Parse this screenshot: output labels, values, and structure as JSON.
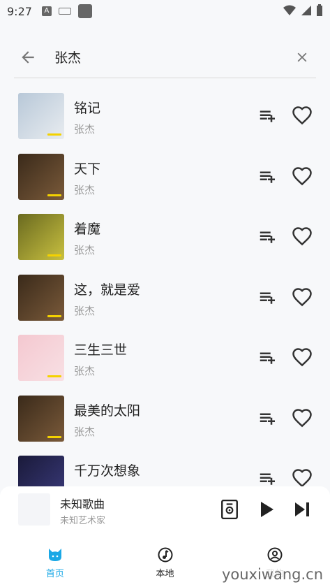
{
  "status_bar": {
    "time": "9:27",
    "left_icons": [
      "a-icon",
      "keyboard-icon",
      "square-icon"
    ],
    "right_icons": [
      "wifi-icon",
      "signal-icon",
      "battery-icon"
    ]
  },
  "search": {
    "query": "张杰",
    "back_icon": "arrow-left-icon",
    "clear_icon": "close-icon"
  },
  "songs": [
    {
      "title": "铭记",
      "artist": "张杰",
      "cover_colors": [
        "#b8c8d8",
        "#e8ecf0"
      ]
    },
    {
      "title": "天下",
      "artist": "张杰",
      "cover_colors": [
        "#3a2a1a",
        "#7a5a3a"
      ]
    },
    {
      "title": "着魔",
      "artist": "张杰",
      "cover_colors": [
        "#6a6a20",
        "#c8c040"
      ]
    },
    {
      "title": "这，就是爱",
      "artist": "张杰",
      "cover_colors": [
        "#3a2a1a",
        "#7a5a3a"
      ]
    },
    {
      "title": "三生三世",
      "artist": "张杰",
      "cover_colors": [
        "#f4c8d0",
        "#f8e0e4"
      ]
    },
    {
      "title": "最美的太阳",
      "artist": "张杰",
      "cover_colors": [
        "#3a2a1a",
        "#7a5a3a"
      ]
    },
    {
      "title": "千万次想象",
      "artist": "张杰",
      "cover_colors": [
        "#1a1a3a",
        "#3a3a7a"
      ]
    }
  ],
  "row_icons": {
    "add": "playlist-add-icon",
    "fav": "heart-icon"
  },
  "player": {
    "title": "未知歌曲",
    "artist": "未知艺术家",
    "icons": [
      "lyrics-icon",
      "play-icon",
      "skip-next-icon"
    ]
  },
  "nav": {
    "items": [
      {
        "label": "首页",
        "icon": "cat-icon",
        "active": true
      },
      {
        "label": "本地",
        "icon": "music-note-icon",
        "active": false
      },
      {
        "label": "我的",
        "icon": "person-icon",
        "active": false
      }
    ]
  },
  "colors": {
    "accent": "#1aa8e6",
    "cover_tag": "#f4d200"
  },
  "watermark": "youxiwang.cn"
}
